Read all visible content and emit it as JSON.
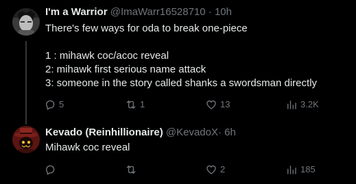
{
  "tweets": [
    {
      "display_name": "I'm a Warrior",
      "handle": "@ImaWarr16528710",
      "separator": "·",
      "time": "10h",
      "lines": [
        "There's few ways for oda to break one-piece",
        "",
        "1 : mihawk coc/acoc reveal",
        "2: mihawk first serious name attack",
        "3: someone in the story called shanks a swordsman directly"
      ],
      "actions": {
        "replies": "5",
        "retweets": "1",
        "likes": "13",
        "views": "3.2K"
      }
    },
    {
      "display_name": "Kevado (Reinhillionaire)",
      "handle": "@KevadoX",
      "separator": "·",
      "time": "6h",
      "lines": [
        "Mihawk coc reveal"
      ],
      "actions": {
        "replies": "",
        "retweets": "",
        "likes": "2",
        "views": "185"
      }
    }
  ],
  "colors": {
    "background": "#000000",
    "primary_text": "#e7e9ea",
    "secondary_text": "#71767b",
    "thread_line": "#333639"
  },
  "icons": [
    "reply-icon",
    "retweet-icon",
    "like-icon",
    "views-icon"
  ]
}
